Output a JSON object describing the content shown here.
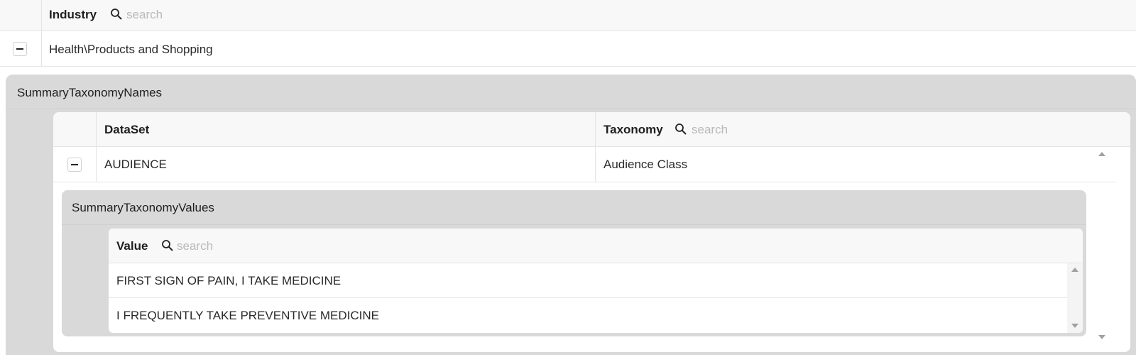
{
  "top_grid": {
    "column_header": "Industry",
    "search_placeholder": "search",
    "row_value": "Health\\Products and Shopping"
  },
  "summary_taxonomy_names": {
    "panel_title": "SummaryTaxonomyNames",
    "columns": [
      "DataSet",
      "Taxonomy"
    ],
    "search_placeholder": "search",
    "row": {
      "dataset": "AUDIENCE",
      "taxonomy": "Audience Class"
    }
  },
  "summary_taxonomy_values": {
    "panel_title": "SummaryTaxonomyValues",
    "column_header": "Value",
    "search_placeholder": "search",
    "rows": [
      "FIRST SIGN OF PAIN, I TAKE MEDICINE",
      "I FREQUENTLY TAKE PREVENTIVE MEDICINE"
    ]
  },
  "icons": [
    "search-icon",
    "collapse-icon",
    "scroll-up-icon",
    "scroll-down-icon"
  ]
}
